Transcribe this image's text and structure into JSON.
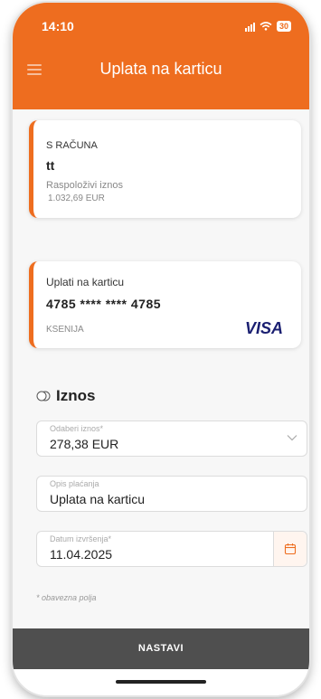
{
  "status_bar": {
    "time": "14:10",
    "battery": "30"
  },
  "header": {
    "title": "Uplata na karticu"
  },
  "source_account": {
    "label": "S RAČUNA",
    "name": "tt",
    "available_label": "Raspoloživi iznos",
    "available_value": "1.032,69 EUR"
  },
  "target_card": {
    "label": "Uplati na karticu",
    "number": "4785 **** **** 4785",
    "holder": "KSENIJA",
    "brand": "VISA"
  },
  "amount_section": {
    "title": "Iznos",
    "icon": "coins-icon"
  },
  "form": {
    "amount": {
      "label": "Odaberi iznos*",
      "value": "278,38 EUR"
    },
    "description": {
      "label": "Opis plaćanja",
      "value": "Uplata na karticu"
    },
    "date": {
      "label": "Datum izvršenja*",
      "value": "11.04.2025"
    }
  },
  "required_note": "* obavezna polja",
  "actions": {
    "continue_label": "NASTAVI"
  },
  "colors": {
    "accent": "#ee6d1f",
    "button": "#4f4f4f",
    "visa": "#1a1f71"
  }
}
